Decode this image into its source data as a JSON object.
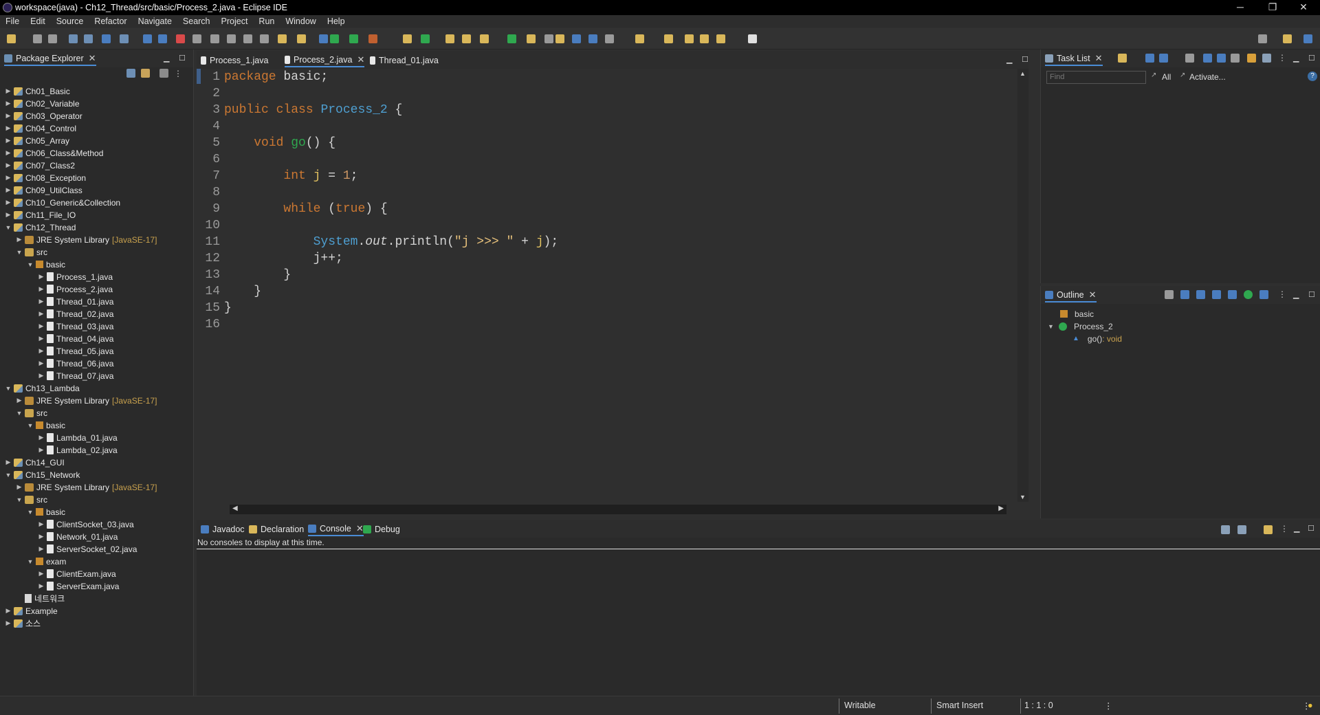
{
  "window": {
    "title": "workspace(java) - Ch12_Thread/src/basic/Process_2.java - Eclipse IDE",
    "minimize": "─",
    "restore": "❐",
    "close": "✕"
  },
  "menu": [
    "File",
    "Edit",
    "Source",
    "Refactor",
    "Navigate",
    "Search",
    "Project",
    "Run",
    "Window",
    "Help"
  ],
  "package_explorer": {
    "title": "Package Explorer",
    "items": [
      {
        "label": "Ch01_Basic",
        "depth": 0,
        "kind": "proj",
        "open": false
      },
      {
        "label": "Ch02_Variable",
        "depth": 0,
        "kind": "proj",
        "open": false
      },
      {
        "label": "Ch03_Operator",
        "depth": 0,
        "kind": "proj",
        "open": false
      },
      {
        "label": "Ch04_Control",
        "depth": 0,
        "kind": "proj",
        "open": false
      },
      {
        "label": "Ch05_Array",
        "depth": 0,
        "kind": "proj",
        "open": false
      },
      {
        "label": "Ch06_Class&Method",
        "depth": 0,
        "kind": "proj",
        "open": false
      },
      {
        "label": "Ch07_Class2",
        "depth": 0,
        "kind": "proj",
        "open": false
      },
      {
        "label": "Ch08_Exception",
        "depth": 0,
        "kind": "proj",
        "open": false
      },
      {
        "label": "Ch09_UtilClass",
        "depth": 0,
        "kind": "proj",
        "open": false
      },
      {
        "label": "Ch10_Generic&Collection",
        "depth": 0,
        "kind": "proj",
        "open": false
      },
      {
        "label": "Ch11_File_IO",
        "depth": 0,
        "kind": "proj",
        "open": false
      },
      {
        "label": "Ch12_Thread",
        "depth": 0,
        "kind": "proj",
        "open": true
      },
      {
        "label": "JRE System Library",
        "tag": "[JavaSE-17]",
        "depth": 1,
        "kind": "jre",
        "open": false
      },
      {
        "label": "src",
        "depth": 1,
        "kind": "src",
        "open": true
      },
      {
        "label": "basic",
        "depth": 2,
        "kind": "pkg",
        "open": true
      },
      {
        "label": "Process_1.java",
        "depth": 3,
        "kind": "java",
        "open": false
      },
      {
        "label": "Process_2.java",
        "depth": 3,
        "kind": "java",
        "open": false
      },
      {
        "label": "Thread_01.java",
        "depth": 3,
        "kind": "java",
        "open": false
      },
      {
        "label": "Thread_02.java",
        "depth": 3,
        "kind": "java",
        "open": false
      },
      {
        "label": "Thread_03.java",
        "depth": 3,
        "kind": "java",
        "open": false
      },
      {
        "label": "Thread_04.java",
        "depth": 3,
        "kind": "java",
        "open": false
      },
      {
        "label": "Thread_05.java",
        "depth": 3,
        "kind": "java",
        "open": false
      },
      {
        "label": "Thread_06.java",
        "depth": 3,
        "kind": "java",
        "open": false
      },
      {
        "label": "Thread_07.java",
        "depth": 3,
        "kind": "java",
        "open": false
      },
      {
        "label": "Ch13_Lambda",
        "depth": 0,
        "kind": "proj",
        "open": true
      },
      {
        "label": "JRE System Library",
        "tag": "[JavaSE-17]",
        "depth": 1,
        "kind": "jre",
        "open": false
      },
      {
        "label": "src",
        "depth": 1,
        "kind": "src",
        "open": true
      },
      {
        "label": "basic",
        "depth": 2,
        "kind": "pkg",
        "open": true
      },
      {
        "label": "Lambda_01.java",
        "depth": 3,
        "kind": "java",
        "open": false
      },
      {
        "label": "Lambda_02.java",
        "depth": 3,
        "kind": "java",
        "open": false
      },
      {
        "label": "Ch14_GUI",
        "depth": 0,
        "kind": "proj",
        "open": false
      },
      {
        "label": "Ch15_Network",
        "depth": 0,
        "kind": "proj",
        "open": true
      },
      {
        "label": "JRE System Library",
        "tag": "[JavaSE-17]",
        "depth": 1,
        "kind": "jre",
        "open": false
      },
      {
        "label": "src",
        "depth": 1,
        "kind": "src",
        "open": true
      },
      {
        "label": "basic",
        "depth": 2,
        "kind": "pkg",
        "open": true
      },
      {
        "label": "ClientSocket_03.java",
        "depth": 3,
        "kind": "java",
        "open": false
      },
      {
        "label": "Network_01.java",
        "depth": 3,
        "kind": "java",
        "open": false
      },
      {
        "label": "ServerSocket_02.java",
        "depth": 3,
        "kind": "java",
        "open": false
      },
      {
        "label": "exam",
        "depth": 2,
        "kind": "pkg",
        "open": true
      },
      {
        "label": "ClientExam.java",
        "depth": 3,
        "kind": "java",
        "open": false
      },
      {
        "label": "ServerExam.java",
        "depth": 3,
        "kind": "java",
        "open": false
      },
      {
        "label": "네트워크",
        "depth": 1,
        "kind": "file",
        "open": null
      },
      {
        "label": "Example",
        "depth": 0,
        "kind": "proj",
        "open": false
      },
      {
        "label": "소스",
        "depth": 0,
        "kind": "proj",
        "open": false
      }
    ]
  },
  "editor": {
    "tabs": [
      {
        "label": "Process_1.java",
        "active": false
      },
      {
        "label": "Process_2.java",
        "active": true
      },
      {
        "label": "Thread_01.java",
        "active": false
      }
    ],
    "lines": [
      [
        [
          "kw",
          "package"
        ],
        [
          "pl",
          " basic;"
        ]
      ],
      [],
      [
        [
          "kw",
          "public"
        ],
        [
          "pl",
          " "
        ],
        [
          "kw",
          "class"
        ],
        [
          "pl",
          " "
        ],
        [
          "ty",
          "Process_2"
        ],
        [
          "pl",
          " {"
        ]
      ],
      [],
      [
        [
          "pl",
          "    "
        ],
        [
          "kw",
          "void"
        ],
        [
          "pl",
          " "
        ],
        [
          "fn",
          "go"
        ],
        [
          "pl",
          "() {"
        ]
      ],
      [],
      [
        [
          "pl",
          "        "
        ],
        [
          "kw",
          "int"
        ],
        [
          "pl",
          " "
        ],
        [
          "vr",
          "j"
        ],
        [
          "pl",
          " = "
        ],
        [
          "nm",
          "1"
        ],
        [
          "pl",
          ";"
        ]
      ],
      [],
      [
        [
          "pl",
          "        "
        ],
        [
          "kw",
          "while"
        ],
        [
          "pl",
          " ("
        ],
        [
          "kw",
          "true"
        ],
        [
          "pl",
          ") {"
        ]
      ],
      [],
      [
        [
          "pl",
          "            "
        ],
        [
          "ty",
          "System"
        ],
        [
          "pl",
          "."
        ],
        [
          "it",
          "out"
        ],
        [
          "pl",
          ".println("
        ],
        [
          "st",
          "\"j >>> \""
        ],
        [
          "pl",
          " + "
        ],
        [
          "vr",
          "j"
        ],
        [
          "pl",
          ");"
        ]
      ],
      [
        [
          "pl",
          "            j++;"
        ]
      ],
      [
        [
          "pl",
          "        }"
        ]
      ],
      [
        [
          "pl",
          "    }"
        ]
      ],
      [
        [
          "pl",
          "}"
        ]
      ],
      []
    ]
  },
  "task_list": {
    "title": "Task List",
    "find_placeholder": "Find",
    "all": "All",
    "activate": "Activate..."
  },
  "outline": {
    "title": "Outline",
    "items": [
      {
        "label": "basic",
        "detail": ""
      },
      {
        "label": "Process_2",
        "detail": ""
      },
      {
        "label": "go()",
        "detail": " : void"
      }
    ]
  },
  "bottom": {
    "tabs": [
      {
        "label": "Javadoc",
        "active": false
      },
      {
        "label": "Declaration",
        "active": false
      },
      {
        "label": "Console",
        "active": true
      },
      {
        "label": "Debug",
        "active": false
      }
    ],
    "message": "No consoles to display at this time."
  },
  "status": {
    "writable": "Writable",
    "insert": "Smart Insert",
    "position": "1 : 1 : 0"
  }
}
